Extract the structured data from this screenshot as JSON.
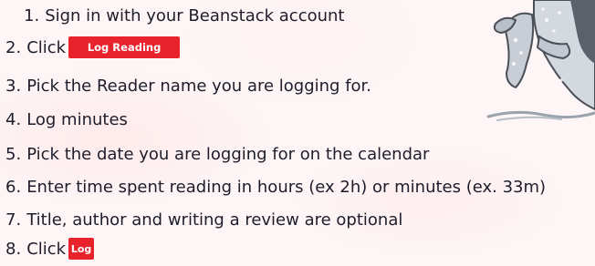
{
  "steps": [
    {
      "number": "1.",
      "text": "Sign in with your Beanstack account"
    },
    {
      "number": "2.",
      "text": "Click",
      "button_label": "Log Reading"
    },
    {
      "number": "3.",
      "text": "Pick the Reader name you are logging for."
    },
    {
      "number": "4.",
      "text": "Log minutes"
    },
    {
      "number": "5.",
      "text": "Pick the date you are logging for on the calendar"
    },
    {
      "number": "6.",
      "text": "Enter time spent reading in hours (ex 2h) or minutes (ex. 33m)"
    },
    {
      "number": "7.",
      "text": "Title, author and writing a review are optional"
    },
    {
      "number": "8.",
      "text": "Click",
      "button_label": "Log"
    }
  ],
  "colors": {
    "button_bg": "#e8232c",
    "text": "#1d1d2b"
  },
  "illustration": {
    "icon": "cartoon-creature-illustration"
  }
}
